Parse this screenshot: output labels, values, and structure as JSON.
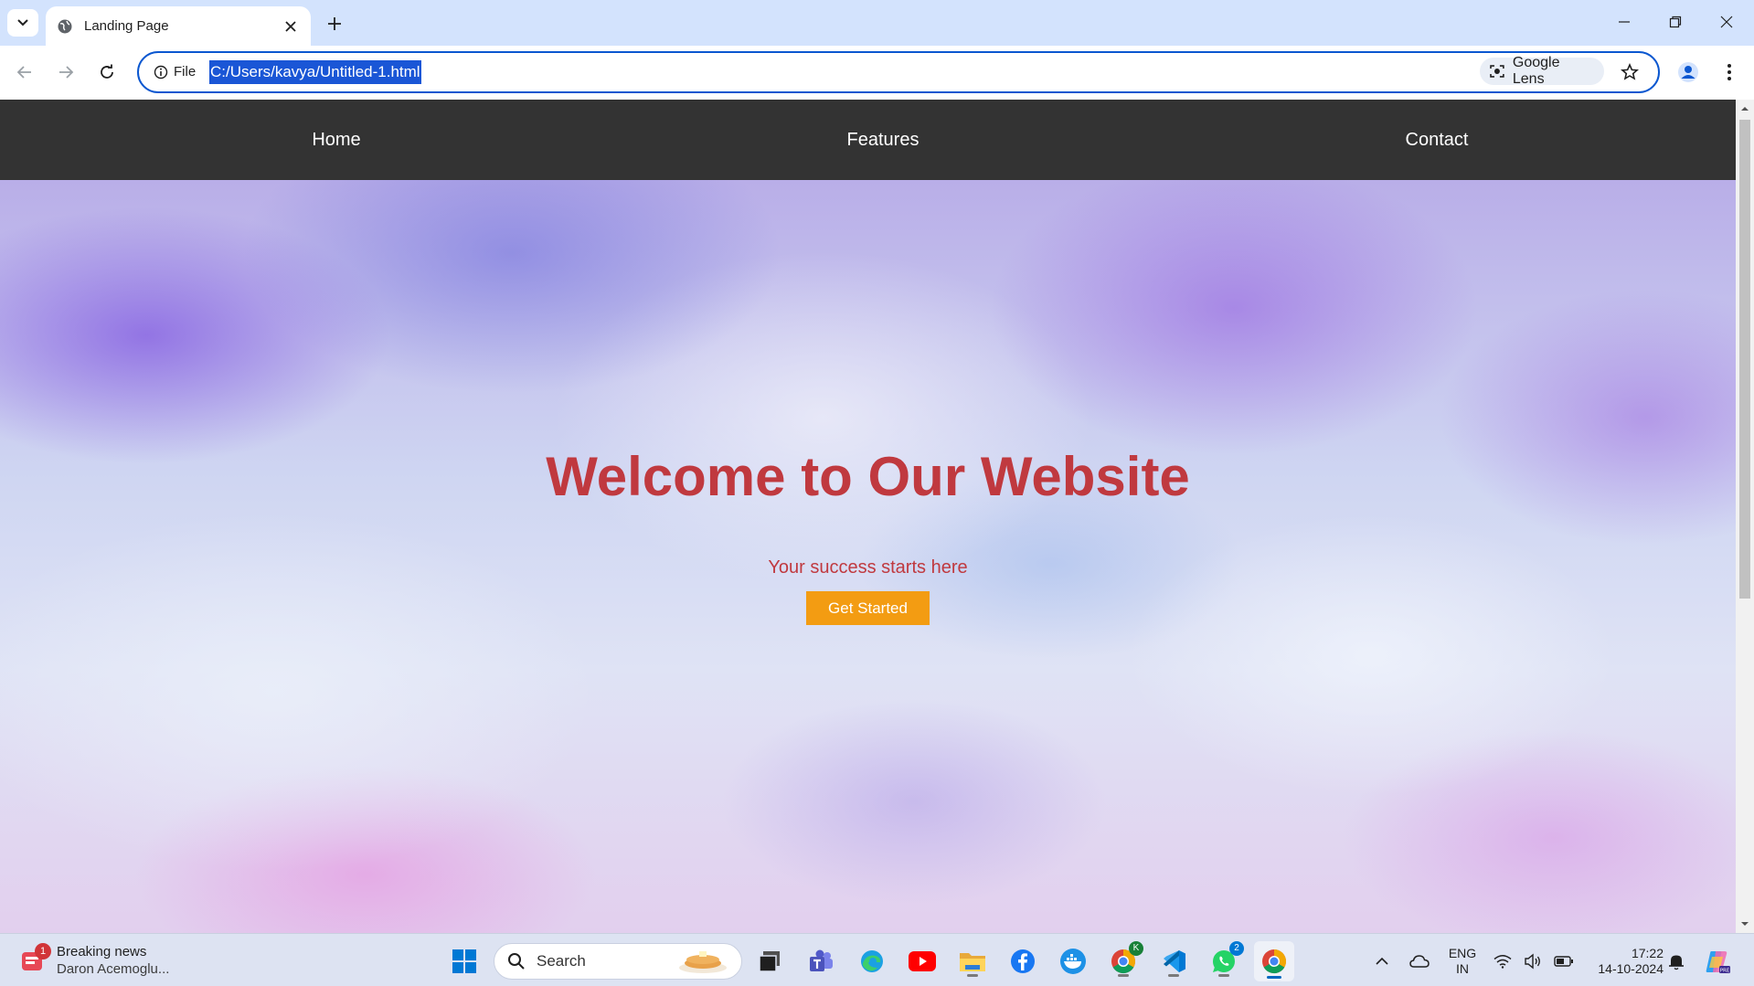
{
  "browser": {
    "tab_title": "Landing Page",
    "site_info_label": "File",
    "url": "C:/Users/kavya/Untitled-1.html",
    "lens_label": "Google Lens"
  },
  "site": {
    "nav": {
      "home": "Home",
      "features": "Features",
      "contact": "Contact"
    },
    "hero": {
      "title": "Welcome to Our Website",
      "subtitle": "Your success starts here",
      "button": "Get Started"
    },
    "colors": {
      "nav_bg": "#333333",
      "title": "#c0393f",
      "button": "#f39c12"
    }
  },
  "taskbar": {
    "news_badge": "1",
    "news_title": "Breaking news",
    "news_sub": "Daron Acemoglu...",
    "search_label": "Search",
    "teams_badge": "",
    "chrome_profile_badge": "K",
    "whatsapp_badge": "2",
    "lang_top": "ENG",
    "lang_bottom": "IN",
    "time": "17:22",
    "date": "14-10-2024"
  }
}
